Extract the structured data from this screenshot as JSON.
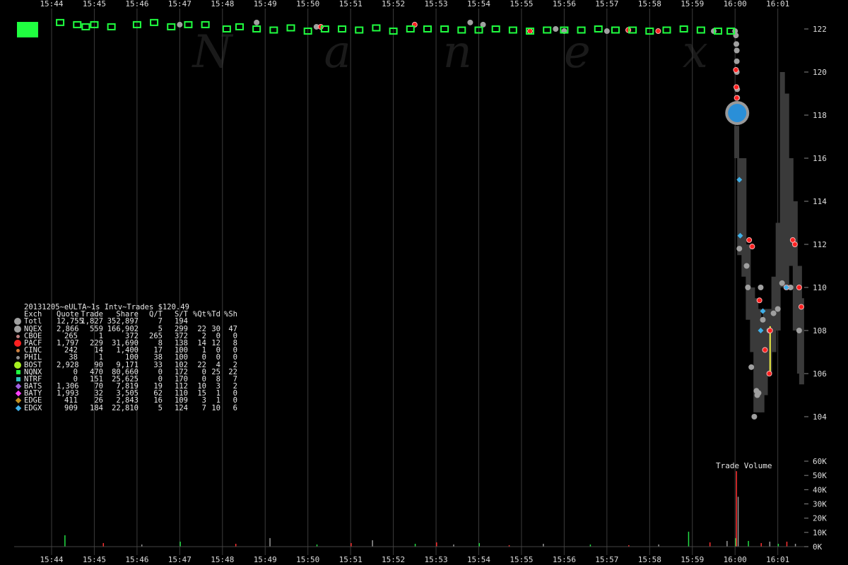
{
  "chart_data": [
    {
      "type": "scatter",
      "title": "20131205~eULTA~1s Intv~Trades $120.49",
      "watermark": "Nanex",
      "x_ticks": [
        "15:44",
        "15:45",
        "15:46",
        "15:47",
        "15:48",
        "15:49",
        "15:50",
        "15:51",
        "15:52",
        "15:53",
        "15:54",
        "15:55",
        "15:56",
        "15:57",
        "15:58",
        "15:59",
        "16:00",
        "16:01"
      ],
      "x_range": [
        "15:43:33",
        "16:02:24"
      ],
      "y_ticks": [
        104,
        106,
        108,
        110,
        112,
        114,
        116,
        118,
        120,
        122
      ],
      "ylim": [
        103.05,
        123.0
      ],
      "axis_side": "right",
      "grid": "vertical",
      "background": "#000000",
      "series": [
        {
          "name": "NQEX",
          "color": "#a0a0a0",
          "marker": "circle",
          "points": [
            [
              3.0,
              122.2
            ],
            [
              4.8,
              122.3
            ],
            [
              6.2,
              122.1
            ],
            [
              9.8,
              122.3
            ],
            [
              10.1,
              122.2
            ],
            [
              11.8,
              122.0
            ],
            [
              12.0,
              121.9
            ],
            [
              13.0,
              121.9
            ],
            [
              13.5,
              121.95
            ],
            [
              15.5,
              121.9
            ],
            [
              16.0,
              121.9
            ],
            [
              16.02,
              121.7
            ],
            [
              16.03,
              121.3
            ],
            [
              16.04,
              121.0
            ],
            [
              16.04,
              120.5
            ],
            [
              16.04,
              120.0
            ],
            [
              16.05,
              119.2
            ],
            [
              16.05,
              118.8
            ],
            [
              16.1,
              111.8
            ],
            [
              16.27,
              111.0
            ],
            [
              16.3,
              110.0
            ],
            [
              16.38,
              106.3
            ],
            [
              16.45,
              104.0
            ],
            [
              16.5,
              105.2
            ],
            [
              16.52,
              105.0
            ],
            [
              16.55,
              105.1
            ],
            [
              16.6,
              110.0
            ],
            [
              16.65,
              108.5
            ],
            [
              16.8,
              108.0
            ],
            [
              16.9,
              108.8
            ],
            [
              17.0,
              109.0
            ],
            [
              17.1,
              110.2
            ],
            [
              17.3,
              110.0
            ],
            [
              17.5,
              108.0
            ]
          ]
        },
        {
          "name": "PACF",
          "color": "#ff2020",
          "marker": "circle",
          "points": [
            [
              6.3,
              122.1
            ],
            [
              8.5,
              122.2
            ],
            [
              11.2,
              121.9
            ],
            [
              13.5,
              121.95
            ],
            [
              14.2,
              121.9
            ],
            [
              16.02,
              120.1
            ],
            [
              16.03,
              119.3
            ],
            [
              16.04,
              118.8
            ],
            [
              16.33,
              112.2
            ],
            [
              16.4,
              111.9
            ],
            [
              16.57,
              109.4
            ],
            [
              16.7,
              107.1
            ],
            [
              16.8,
              106.0
            ],
            [
              16.82,
              108.0
            ],
            [
              17.2,
              110.0
            ],
            [
              17.35,
              112.2
            ],
            [
              17.4,
              112.0
            ],
            [
              17.5,
              110.0
            ],
            [
              17.55,
              109.1
            ]
          ]
        },
        {
          "name": "BOST",
          "color": "#20ff40",
          "marker": "square",
          "points": [
            [
              0.2,
              122.3
            ],
            [
              0.6,
              122.2
            ],
            [
              0.8,
              122.1
            ],
            [
              1.0,
              122.2
            ],
            [
              1.4,
              122.1
            ],
            [
              2.0,
              122.2
            ],
            [
              2.4,
              122.3
            ],
            [
              2.8,
              122.1
            ],
            [
              3.2,
              122.2
            ],
            [
              3.6,
              122.2
            ],
            [
              4.1,
              122.0
            ],
            [
              4.4,
              122.1
            ],
            [
              4.8,
              122.0
            ],
            [
              5.2,
              121.95
            ],
            [
              5.6,
              122.05
            ],
            [
              6.0,
              121.9
            ],
            [
              6.4,
              122.0
            ],
            [
              6.8,
              122.0
            ],
            [
              7.2,
              121.95
            ],
            [
              7.6,
              122.05
            ],
            [
              8.0,
              121.9
            ],
            [
              8.4,
              122.0
            ],
            [
              8.8,
              122.0
            ],
            [
              9.2,
              122.0
            ],
            [
              9.6,
              121.95
            ],
            [
              10.0,
              121.95
            ],
            [
              10.4,
              122.0
            ],
            [
              10.8,
              121.95
            ],
            [
              11.2,
              121.9
            ],
            [
              11.6,
              121.95
            ],
            [
              12.0,
              121.95
            ],
            [
              12.4,
              121.95
            ],
            [
              12.8,
              122.0
            ],
            [
              13.2,
              121.95
            ],
            [
              13.6,
              121.95
            ],
            [
              14.0,
              121.9
            ],
            [
              14.4,
              121.95
            ],
            [
              14.8,
              122.0
            ],
            [
              15.2,
              121.95
            ],
            [
              15.6,
              121.9
            ],
            [
              15.9,
              121.9
            ]
          ]
        },
        {
          "name": "EDGX",
          "color": "#40b0e8",
          "marker": "diamond",
          "points": [
            [
              16.05,
              118.0
            ],
            [
              16.1,
              115.0
            ],
            [
              16.12,
              112.4
            ],
            [
              16.6,
              108.0
            ],
            [
              16.65,
              108.9
            ],
            [
              17.2,
              110.0
            ]
          ]
        }
      ],
      "bands": [
        {
          "name": "NBBO spread",
          "color": "#3a3a3a",
          "segments": [
            [
              16.03,
              116.0,
              117.5
            ],
            [
              16.1,
              111.5,
              116.0
            ],
            [
              16.2,
              110.5,
              116.0
            ],
            [
              16.3,
              108.5,
              112.0
            ],
            [
              16.4,
              107.0,
              110.0
            ],
            [
              16.48,
              104.2,
              109.5
            ],
            [
              16.55,
              104.2,
              109.0
            ],
            [
              16.62,
              104.2,
              108.5
            ],
            [
              16.7,
              105.0,
              109.0
            ],
            [
              16.8,
              106.0,
              109.0
            ],
            [
              16.9,
              107.0,
              110.5
            ],
            [
              17.0,
              108.0,
              113.0
            ],
            [
              17.1,
              110.0,
              120.0
            ],
            [
              17.2,
              110.0,
              119.0
            ],
            [
              17.3,
              111.0,
              116.0
            ],
            [
              17.4,
              108.0,
              114.0
            ],
            [
              17.5,
              106.0,
              111.0
            ],
            [
              17.55,
              105.5,
              109.5
            ]
          ]
        }
      ]
    },
    {
      "type": "bar",
      "title": "Trade Volume",
      "y_ticks": [
        "0K",
        "10K",
        "20K",
        "30K",
        "40K",
        "50K",
        "60K"
      ],
      "ylim": [
        0,
        60000
      ],
      "axis_side": "right",
      "bars": [
        [
          0.3,
          8000
        ],
        [
          1.2,
          2500
        ],
        [
          2.1,
          1500
        ],
        [
          3.0,
          3500
        ],
        [
          4.3,
          2000
        ],
        [
          5.1,
          6000
        ],
        [
          6.2,
          1500
        ],
        [
          7.0,
          2500
        ],
        [
          7.5,
          4500
        ],
        [
          8.5,
          2000
        ],
        [
          9.0,
          3000
        ],
        [
          9.4,
          1500
        ],
        [
          10.0,
          2500
        ],
        [
          10.7,
          1000
        ],
        [
          11.5,
          2000
        ],
        [
          12.6,
          1500
        ],
        [
          13.5,
          1000
        ],
        [
          14.2,
          1500
        ],
        [
          14.9,
          10500
        ],
        [
          15.4,
          3000
        ],
        [
          15.8,
          4000
        ],
        [
          16.0,
          6000
        ],
        [
          16.02,
          53000
        ],
        [
          16.06,
          35000
        ],
        [
          16.3,
          4000
        ],
        [
          16.6,
          2500
        ],
        [
          16.8,
          3500
        ],
        [
          17.0,
          2000
        ],
        [
          17.2,
          3500
        ],
        [
          17.4,
          2000
        ]
      ],
      "bar_colors": [
        "#22dd44",
        "#ff3030",
        "#9a9a9a"
      ]
    }
  ],
  "stats_table": {
    "title": "20131205~eULTA~1s Intv~Trades $120.49",
    "header": [
      "Exch",
      "Quote",
      "Trade",
      "Share",
      "Q/T",
      "S/T",
      "%Qt",
      "%Td",
      "%Sh"
    ],
    "rows": [
      {
        "sym": "circle",
        "color": "#a0a0a0",
        "cells": [
          "Totl",
          "12,755",
          "1,827",
          "352,897",
          "7",
          "194",
          "",
          "",
          ""
        ]
      },
      {
        "sym": "circle",
        "color": "#a0a0a0",
        "cells": [
          "NQEX",
          "2,866",
          "559",
          "166,902",
          "5",
          "299",
          "22",
          "30",
          "47"
        ]
      },
      {
        "sym": "dot",
        "color": "#c08080",
        "cells": [
          "CBOE",
          "265",
          "1",
          "372",
          "265",
          "372",
          "2",
          "0",
          "0"
        ]
      },
      {
        "sym": "circle",
        "color": "#ff2020",
        "cells": [
          "PACF",
          "1,797",
          "229",
          "31,690",
          "8",
          "138",
          "14",
          "12",
          "8"
        ]
      },
      {
        "sym": "dot",
        "color": "#d08040",
        "cells": [
          "CINC",
          "242",
          "14",
          "1,400",
          "17",
          "100",
          "1",
          "0",
          "0"
        ]
      },
      {
        "sym": "dot",
        "color": "#909090",
        "cells": [
          "PHIL",
          "38",
          "1",
          "100",
          "38",
          "100",
          "0",
          "0",
          "0"
        ]
      },
      {
        "sym": "circle",
        "color": "#a8f020",
        "cells": [
          "BOST",
          "2,928",
          "90",
          "9,171",
          "33",
          "102",
          "22",
          "4",
          "2"
        ]
      },
      {
        "sym": "square",
        "color": "#20ff40",
        "cells": [
          "NQNX",
          "0",
          "470",
          "80,660",
          "0",
          "172",
          "0",
          "25",
          "22"
        ]
      },
      {
        "sym": "square",
        "color": "#30c0c0",
        "cells": [
          "NTRF",
          "0",
          "151",
          "25,625",
          "0",
          "170",
          "0",
          "8",
          "7"
        ]
      },
      {
        "sym": "diamond",
        "color": "#a060e0",
        "cells": [
          "BATS",
          "1,306",
          "70",
          "7,819",
          "19",
          "112",
          "10",
          "3",
          "2"
        ]
      },
      {
        "sym": "diamond",
        "color": "#ff40ff",
        "cells": [
          "BATY",
          "1,993",
          "32",
          "3,505",
          "62",
          "110",
          "15",
          "1",
          "0"
        ]
      },
      {
        "sym": "diamond",
        "color": "#c09020",
        "cells": [
          "EDGE",
          "411",
          "26",
          "2,843",
          "16",
          "109",
          "3",
          "1",
          "0"
        ]
      },
      {
        "sym": "diamond",
        "color": "#40b0e8",
        "cells": [
          "EDGX",
          "909",
          "184",
          "22,810",
          "5",
          "124",
          "7",
          "10",
          "6"
        ]
      }
    ]
  },
  "volume_title": "Trade Volume"
}
